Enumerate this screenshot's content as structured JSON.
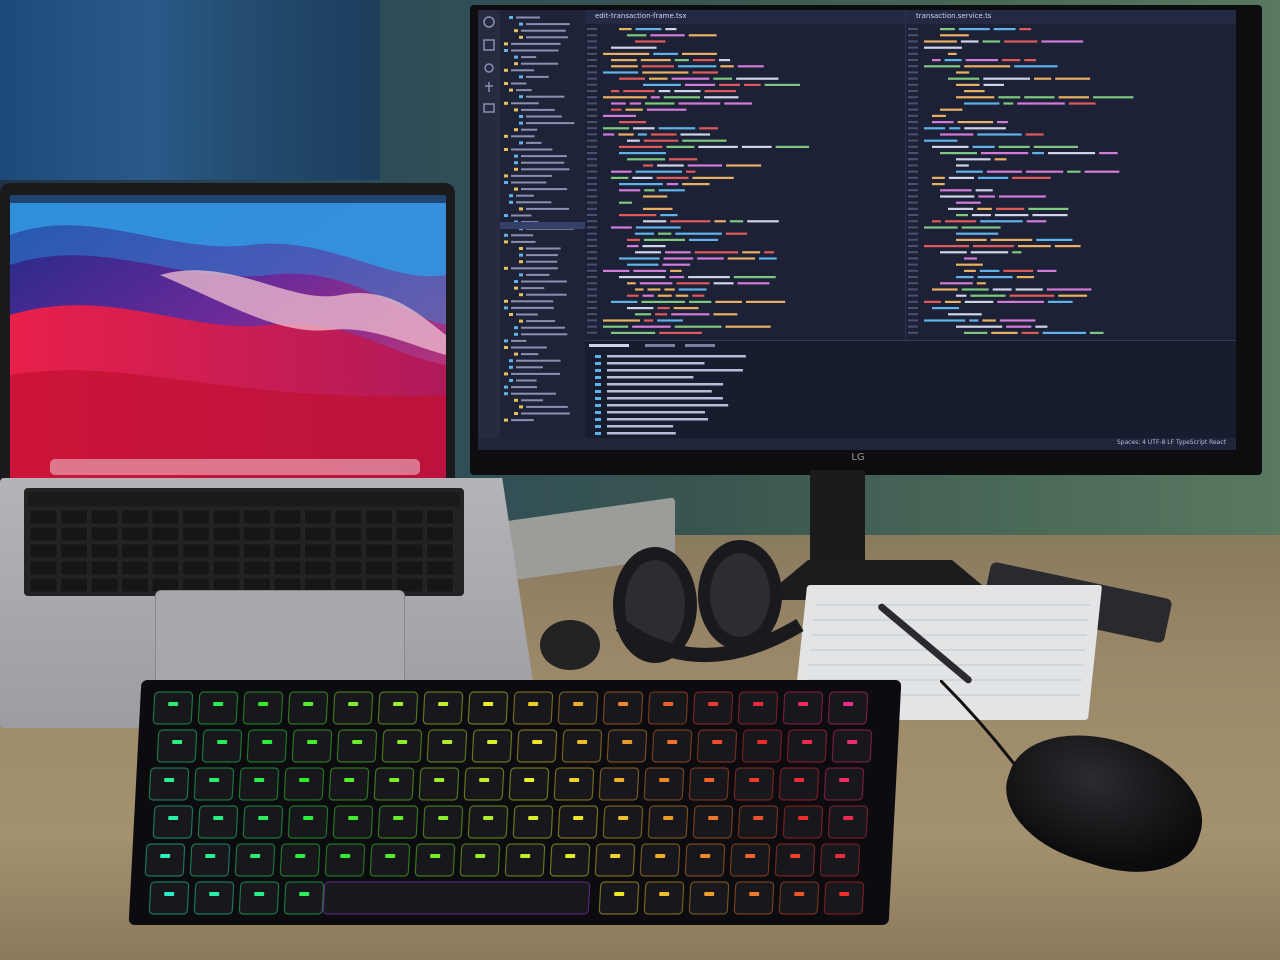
{
  "scene": {
    "description_tags": [
      "desk-setup",
      "laptop",
      "monitor",
      "mechanical-keyboard",
      "mouse",
      "headphones",
      "notebook"
    ]
  },
  "monitor": {
    "brand_text": "LG",
    "editor": {
      "tabs": [
        "edit-transaction-frame.tsx",
        "transaction.service.ts"
      ],
      "status_right": "Spaces: 4  UTF-8  LF  TypeScript React"
    }
  },
  "colors": {
    "code_keyword": "#d37bd8",
    "code_string": "#e8b060",
    "code_var": "#e05a5a",
    "code_type": "#5fb3e8",
    "code_green": "#7ec97e",
    "editor_bg": "#1c2136"
  }
}
